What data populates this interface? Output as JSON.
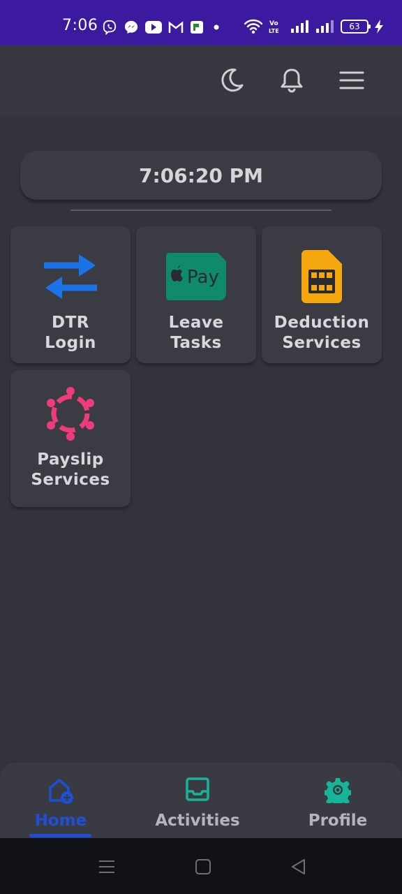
{
  "status_bar": {
    "time": "7:06",
    "battery": "63",
    "icons": [
      "viber-icon",
      "messenger-icon",
      "youtube-icon",
      "gmail-icon",
      "app-icon",
      "dot-icon",
      "wifi-icon",
      "volte-icon",
      "signal-icon",
      "signal-icon",
      "charging-icon"
    ]
  },
  "header": {
    "icons": [
      "moon-icon",
      "bell-icon",
      "menu-icon"
    ]
  },
  "clock": {
    "time": "7:06:20 PM"
  },
  "tiles": [
    {
      "line1": "DTR",
      "line2": "Login",
      "icon": "arrows-swap-icon",
      "color": "#1a73e8"
    },
    {
      "line1": "Leave",
      "line2": "Tasks",
      "icon": "apple-pay-icon",
      "color": "#0f8a6b"
    },
    {
      "line1": "Deduction",
      "line2": "Services",
      "icon": "sim-card-icon",
      "color": "#f5a70f"
    },
    {
      "line1": "Payslip",
      "line2": "Services",
      "icon": "people-circle-icon",
      "color": "#ee3b7b"
    }
  ],
  "nav": {
    "items": [
      {
        "label": "Home",
        "icon": "home-add-icon",
        "active": true
      },
      {
        "label": "Activities",
        "icon": "inbox-icon",
        "active": false
      },
      {
        "label": "Profile",
        "icon": "gear-icon",
        "active": false
      }
    ]
  },
  "colors": {
    "status_bar": "#3b1aa0",
    "background": "#33343b",
    "accent": "#1e4fd8",
    "teal": "#17b49a"
  }
}
